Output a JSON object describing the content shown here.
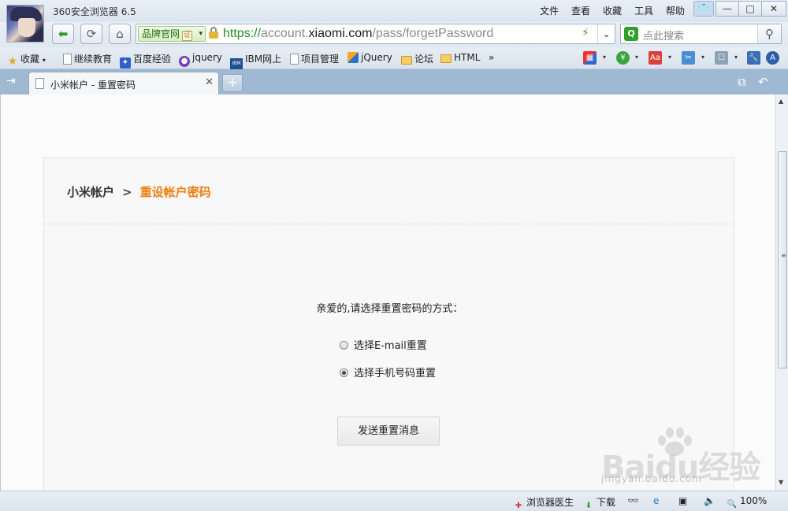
{
  "window": {
    "app_title": "360安全浏览器 6.5",
    "menu": [
      "文件",
      "查看",
      "收藏",
      "工具",
      "帮助"
    ],
    "controls": {
      "minimize": "—",
      "maximize": "□",
      "close": "✕"
    }
  },
  "nav": {
    "brand_badge": "品牌官网",
    "brand_cert": "证",
    "url_scheme": "https://",
    "url_pre": "account.",
    "url_domain": "xiaomi.com",
    "url_path": "/pass/forgetPassword",
    "search_placeholder": "点此搜索"
  },
  "bookmarks": {
    "favorites": "收藏",
    "items": [
      "继续教育",
      "百度经验",
      "jquery",
      "IBM网上",
      "项目管理",
      "jQuery",
      "论坛",
      "HTML"
    ],
    "more": "»",
    "ibm_logo": "IBM"
  },
  "tabs": {
    "active": "小米帐户 - 重置密码",
    "new_tab": "+"
  },
  "page": {
    "crumb_root": "小米帐户",
    "crumb_sep": ">",
    "crumb_current": "重设帐户密码",
    "prompt": "亲爱的,请选择重置密码的方式：",
    "options": [
      {
        "label": "选择E-mail重置",
        "selected": false
      },
      {
        "label": "选择手机号码重置",
        "selected": true
      }
    ],
    "send_button": "发送重置消息"
  },
  "watermark": {
    "brand": "Baidu经验",
    "url": "jingyan.baidu.com"
  },
  "status": {
    "doctor": "浏览器医生",
    "download": "下载",
    "zoom": "100%"
  },
  "colors": {
    "accent_orange": "#f07d0c",
    "url_green": "#239023",
    "tab_bar": "#9fb9d3"
  },
  "icons": [
    "back-arrow",
    "refresh",
    "home",
    "lock",
    "bolt",
    "search",
    "star",
    "folder",
    "shirt-skin"
  ]
}
